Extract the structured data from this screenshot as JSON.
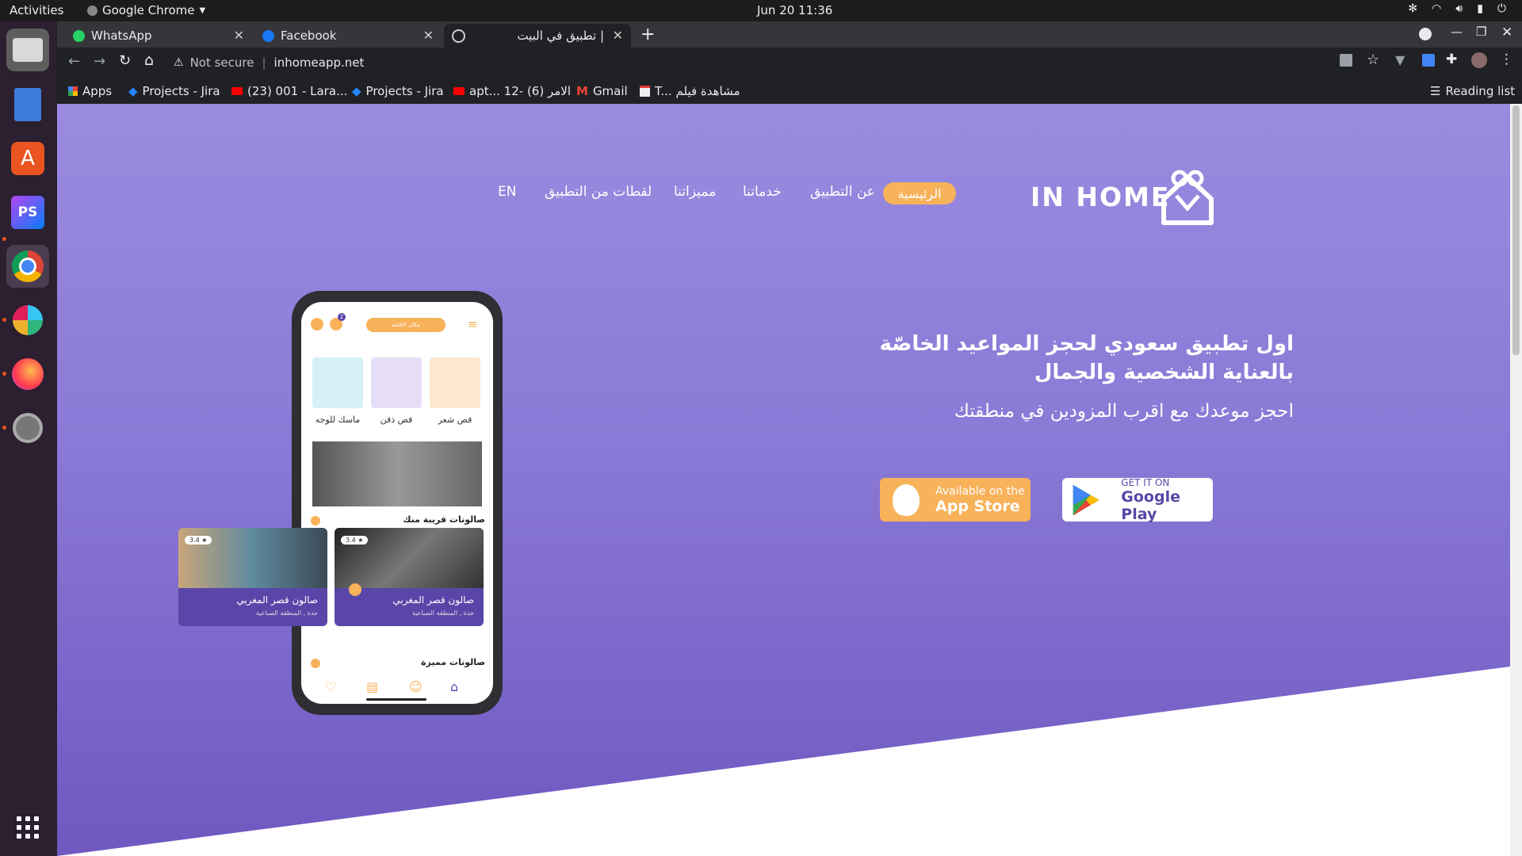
{
  "system": {
    "activities": "Activities",
    "app_name": "Google Chrome",
    "clock": "Jun 20  11:36"
  },
  "browser": {
    "tabs": [
      {
        "title": "WhatsApp",
        "icon": "whatsapp-icon"
      },
      {
        "title": "Facebook",
        "icon": "facebook-icon"
      },
      {
        "title": "تطبيق في البيت |",
        "icon": "globe-icon"
      }
    ],
    "security": "Not secure",
    "url": "inhomeapp.net",
    "bookmarks": [
      {
        "label": "Apps",
        "icon": "apps-grid-icon"
      },
      {
        "label": "Projects - Jira",
        "icon": "jira-icon"
      },
      {
        "label": "(23) 001 - Lara...",
        "icon": "youtube-icon"
      },
      {
        "label": "Projects - Jira",
        "icon": "jira-icon"
      },
      {
        "label": "apt... 12- الامر (6)",
        "icon": "youtube-icon"
      },
      {
        "label": "Gmail",
        "icon": "gmail-icon"
      },
      {
        "label": "T... مشاهدة فيلم",
        "icon": "film-icon"
      }
    ],
    "reading_list": "Reading list"
  },
  "site": {
    "logo_text": "IN HOME",
    "nav": {
      "home": "الرئيسية",
      "about": "عن التطبيق",
      "services": "خدماتنا",
      "features": "مميزاتنا",
      "screenshots": "لقطات من التطبيق",
      "lang": "EN"
    },
    "hero": {
      "title": "اول تطبيق سعودي لحجز المواعيد الخاصّة بالعناية الشخصية والجمال",
      "subtitle": "احجز موعدك مع اقرب المزودين في منطقتك"
    },
    "stores": {
      "apple_small": "Available on the",
      "apple_big": "App Store",
      "google_small": "GET IT ON",
      "google_big": "Google Play"
    },
    "phone": {
      "location_pill": "مكان الاقامة",
      "badge": "2",
      "categories": [
        "قص شعر",
        "قص ذقن",
        "ماسك للوجه"
      ],
      "nearby_heading": "صالونات قريبة منك",
      "featured_heading": "صالونات مميزة",
      "cards": [
        {
          "name": "صالون قصر المغربي",
          "address": "جدة , المنطقة الصناعية",
          "rating": "3.4"
        },
        {
          "name": "صالون قصر المغربي",
          "address": "جدة , المنطقة الصناعية",
          "rating": "3.4"
        }
      ]
    },
    "colors": {
      "accent": "#f8b25a",
      "purple_top": "#9a8be0",
      "purple_bottom": "#6f58c0"
    }
  }
}
